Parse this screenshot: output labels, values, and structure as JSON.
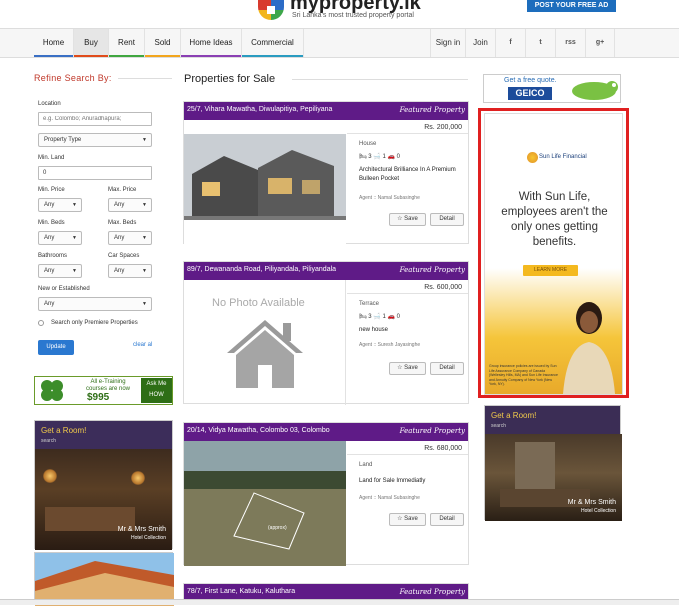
{
  "header": {
    "logo_text": "myproperty.lk",
    "logo_tm": "TM",
    "tagline": "Sri Lanka's most trusted property portal",
    "post_ad": "POST YOUR FREE AD"
  },
  "nav": {
    "items": [
      "Home",
      "Buy",
      "Rent",
      "Sold",
      "Home Ideas",
      "Commercial"
    ],
    "signin": "Sign in",
    "join": "Join",
    "social": [
      "f",
      "t",
      "rss",
      "g+"
    ]
  },
  "sidebar": {
    "title": "Refine Search By:",
    "location_label": "Location",
    "location_placeholder": "e.g. Colombo; Anuradhapura;",
    "property_type": "Property Type",
    "min_land_label": "Min. Land",
    "min_land_value": "0",
    "min_price_label": "Min. Price",
    "max_price_label": "Max. Price",
    "min_beds_label": "Min. Beds",
    "max_beds_label": "Max. Beds",
    "bathrooms_label": "Bathrooms",
    "car_spaces_label": "Car Spaces",
    "new_est_label": "New or Established",
    "any": "Any",
    "premiere_label": "Search only Premiere Properties",
    "update_button": "Update",
    "clear_link": "clear al"
  },
  "ads": {
    "etraining_line1": "All e-Training",
    "etraining_line2": "courses are now",
    "etraining_price": "$995",
    "etraining_cta": "Ask Me HOW",
    "hotel_title": "Get a Room!",
    "hotel_sub": "search",
    "hotel_brand": "Mr & Mrs Smith",
    "hotel_brand_sub": "Hotel Collection",
    "geico_line": "Get a free quote.",
    "geico_brand": "GEICO",
    "sunlife_brand": "Sun Life Financial",
    "sunlife_text": "With Sun Life, employees aren't the only ones getting benefits.",
    "sunlife_button": "LEARN MORE",
    "sunlife_fine": "Group insurance policies are issued by Sun Life Assurance Company of Canada (Wellesley Hills, MA) and Sun Life Insurance and Annuity Company of New York (New York, NY)."
  },
  "main": {
    "title": "Properties for Sale",
    "featured_label": "Featured Property",
    "save_label": "Save",
    "detail_label": "Detail",
    "listings": [
      {
        "address": "25/7, Vihara Mawatha, Diwulapitiya, Pepiliyana",
        "price": "Rs. 200,000",
        "type": "House",
        "beds": "3",
        "baths": "1",
        "cars": "0",
        "description": "Architectural Brilliance In A Premium Bulleen Pocket",
        "agent": "Agent :: Namal Subasinghe"
      },
      {
        "address": "89/7, Dewananda Road, Piliyandala, Piliyandala",
        "price": "Rs. 600,000",
        "type": "Terrace",
        "beds": "3",
        "baths": "1",
        "cars": "0",
        "description": "new house",
        "agent": "Agent :: Suresh Jayasinghe",
        "no_photo": "No Photo Available"
      },
      {
        "address": "20/14, Vidya Mawatha, Colombo 03, Colombo",
        "price": "Rs. 680,000",
        "type": "Land",
        "description": "Land for Sale Immediatly",
        "agent": "Agent :: Namal Subasinghe",
        "map_label": "(approx)"
      },
      {
        "address": "78/7, First Lane, Katuku, Kaluthara"
      }
    ]
  }
}
